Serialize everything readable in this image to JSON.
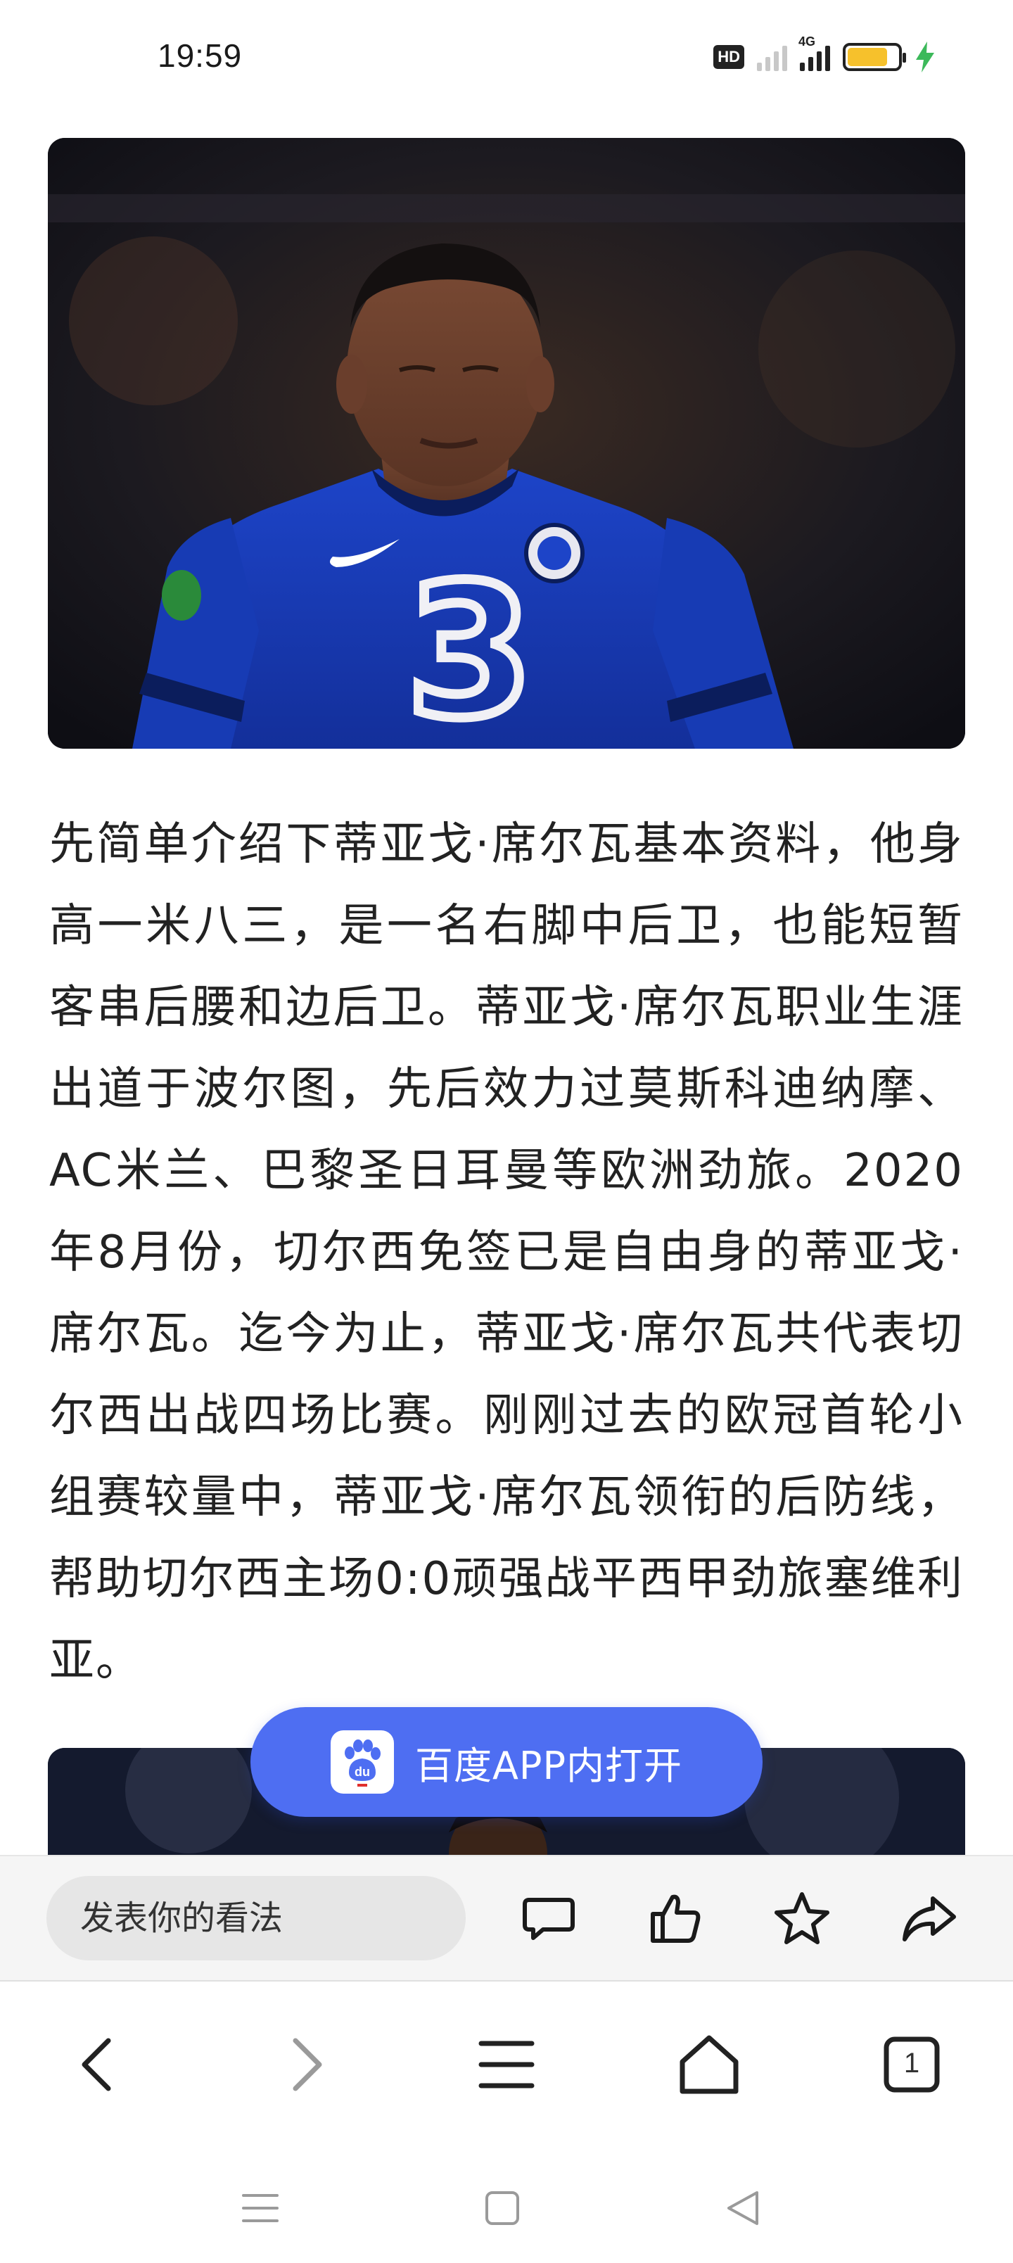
{
  "status_bar": {
    "time": "19:59",
    "hd_label": "HD",
    "network_label": "4G",
    "battery_level": 0.8,
    "battery_color": "#f6c12c",
    "charging_color": "#3cb95a"
  },
  "hero_image": {
    "icon": "soccer-player-photo"
  },
  "article": {
    "paragraph": "先简单介绍下蒂亚戈·席尔瓦基本资料，他身高一米八三，是一名右脚中后卫，也能短暂客串后腰和边后卫。蒂亚戈·席尔瓦职业生涯出道于波尔图，先后效力过莫斯科迪纳摩、AC米兰、巴黎圣日耳曼等欧洲劲旅。2020年8月份，切尔西免签已是自由身的蒂亚戈·席尔瓦。迄今为止，蒂亚戈·席尔瓦共代表切尔西出战四场比赛。刚刚过去的欧冠首轮小组赛较量中，蒂亚戈·席尔瓦领衔的后防线，帮助切尔西主场0:0顽强战平西甲劲旅塞维利亚。"
  },
  "open_app": {
    "label": "百度APP内打开",
    "color": "#4e6ef2"
  },
  "comment_bar": {
    "placeholder": "发表你的看法",
    "icons": [
      "comment-icon",
      "thumbs-up-icon",
      "star-icon",
      "share-icon"
    ]
  },
  "browser_nav": {
    "tab_count": "1",
    "icons": [
      "back-icon",
      "forward-icon",
      "menu-icon",
      "home-icon",
      "tabs-icon"
    ]
  },
  "system_nav": {
    "icons": [
      "recent-apps-icon",
      "home-square-icon",
      "back-triangle-icon"
    ]
  }
}
